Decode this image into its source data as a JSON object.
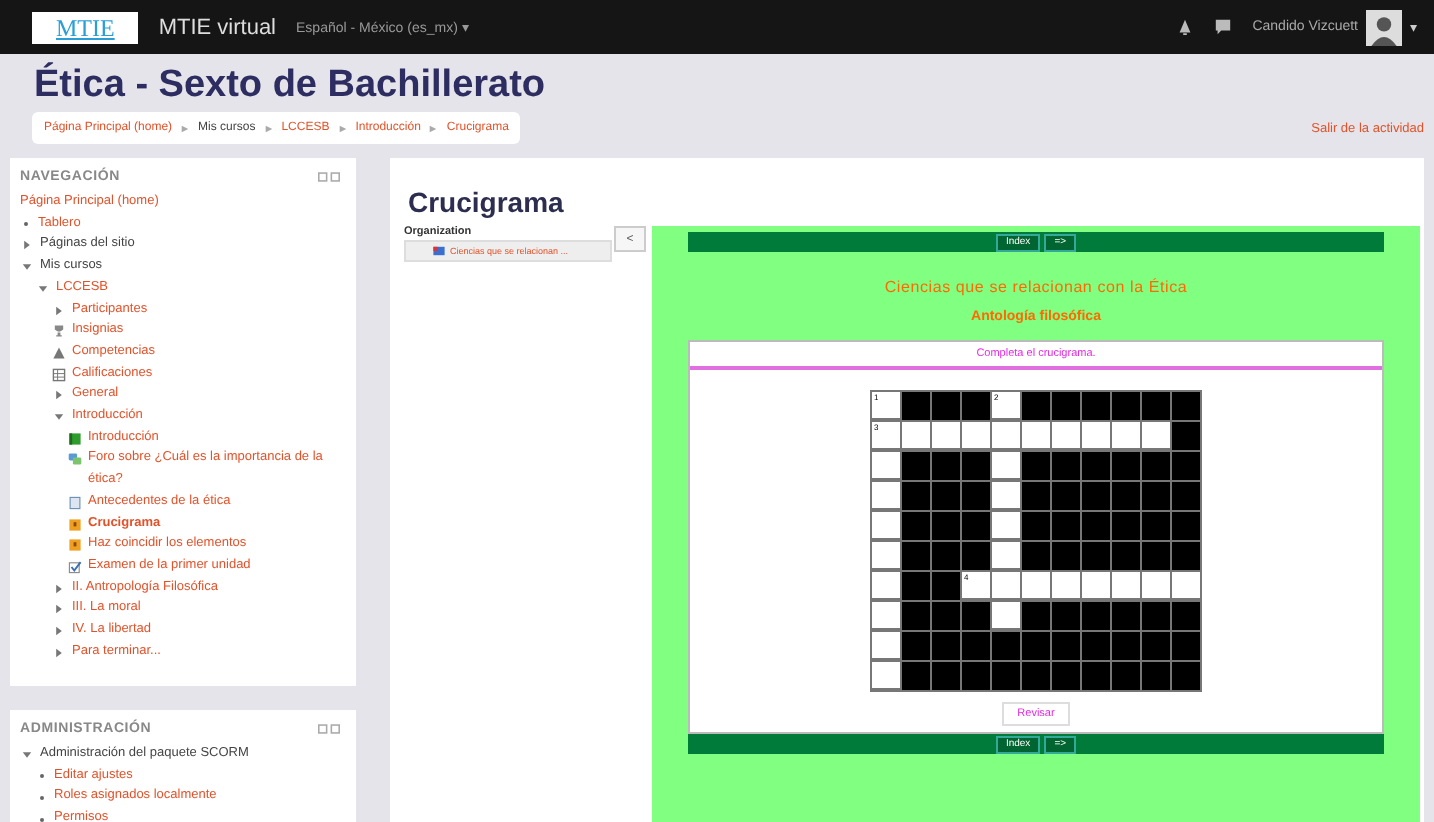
{
  "navbar": {
    "logo": "MTIE",
    "site_name": "MTIE virtual",
    "language": "Español - México (es_mx) ▾",
    "user_name": "Candido Vizcuett",
    "user_caret": "▾"
  },
  "page_title": "Ética - Sexto de Bachillerato",
  "breadcrumb": [
    {
      "label": "Página Principal (home)",
      "link": true
    },
    {
      "label": "Mis cursos",
      "link": false
    },
    {
      "label": "LCCESB",
      "link": true
    },
    {
      "label": "Introducción",
      "link": true
    },
    {
      "label": "Crucigrama",
      "link": true
    }
  ],
  "exit_link": "Salir de la actividad",
  "navigation": {
    "title": "NAVEGACIÓN",
    "items": [
      {
        "label": "Página Principal (home)",
        "kind": "plain",
        "link": true
      },
      {
        "label": "Tablero",
        "kind": "bullet",
        "link": true
      },
      {
        "label": "Páginas del sitio",
        "kind": "collapsed",
        "link": false
      },
      {
        "label": "Mis cursos",
        "kind": "expanded",
        "link": false,
        "children": [
          {
            "label": "LCCESB",
            "kind": "expanded",
            "link": true,
            "children": [
              {
                "label": "Participantes",
                "kind": "collapsed",
                "link": true
              },
              {
                "label": "Insignias",
                "kind": "badges",
                "link": true
              },
              {
                "label": "Competencias",
                "kind": "competencies",
                "link": true
              },
              {
                "label": "Calificaciones",
                "kind": "grades",
                "link": true
              },
              {
                "label": "General",
                "kind": "collapsed",
                "link": true
              },
              {
                "label": "Introducción",
                "kind": "expanded",
                "link": true,
                "children": [
                  {
                    "label": "Introducción",
                    "kind": "page",
                    "link": true,
                    "selected": false
                  },
                  {
                    "label": "Foro sobre ¿Cuál es la importancia de la ética?",
                    "kind": "forum",
                    "link": true,
                    "selected": false
                  },
                  {
                    "label": "Antecedentes de la ética",
                    "kind": "file",
                    "link": true,
                    "selected": false
                  },
                  {
                    "label": "Crucigrama",
                    "kind": "scorm",
                    "link": true,
                    "selected": true
                  },
                  {
                    "label": "Haz coincidir los elementos",
                    "kind": "scorm",
                    "link": true,
                    "selected": false
                  },
                  {
                    "label": "Examen de la primer unidad",
                    "kind": "quiz",
                    "link": true,
                    "selected": false
                  }
                ]
              },
              {
                "label": "II. Antropología Filosófica",
                "kind": "collapsed",
                "link": true
              },
              {
                "label": "III. La moral",
                "kind": "collapsed",
                "link": true
              },
              {
                "label": "IV. La libertad",
                "kind": "collapsed",
                "link": true
              },
              {
                "label": "Para terminar...",
                "kind": "collapsed",
                "link": true
              }
            ]
          }
        ]
      }
    ]
  },
  "administration": {
    "title": "ADMINISTRACIÓN",
    "items": [
      {
        "label": "Administración del paquete SCORM",
        "kind": "expanded",
        "link": false,
        "children": [
          {
            "label": "Editar ajustes",
            "kind": "bullet",
            "link": true
          },
          {
            "label": "Roles asignados localmente",
            "kind": "bullet",
            "link": true
          },
          {
            "label": "Permisos",
            "kind": "bullet",
            "link": true
          }
        ]
      }
    ]
  },
  "activity": {
    "title": "Crucigrama",
    "organization_label": "Organization",
    "organization_item": "Ciencias que se relacionan ...",
    "toggle_button": "<",
    "nav_top": [
      "Index",
      "=>"
    ],
    "heading": "Ciencias que se relacionan con la Ética",
    "subheading": "Antología filosófica",
    "instructions": "Completa el crucigrama.",
    "grid": [
      [
        {
          "open": true,
          "number": "1"
        },
        {
          "open": false
        },
        {
          "open": false
        },
        {
          "open": false
        },
        {
          "open": true,
          "number": "2"
        },
        {
          "open": false
        },
        {
          "open": false
        },
        {
          "open": false
        },
        {
          "open": false
        },
        {
          "open": false
        },
        {
          "open": false
        }
      ],
      [
        {
          "open": true,
          "number": "3"
        },
        {
          "open": true
        },
        {
          "open": true
        },
        {
          "open": true
        },
        {
          "open": true
        },
        {
          "open": true
        },
        {
          "open": true
        },
        {
          "open": true
        },
        {
          "open": true
        },
        {
          "open": true
        },
        {
          "open": false
        }
      ],
      [
        {
          "open": true
        },
        {
          "open": false
        },
        {
          "open": false
        },
        {
          "open": false
        },
        {
          "open": true
        },
        {
          "open": false
        },
        {
          "open": false
        },
        {
          "open": false
        },
        {
          "open": false
        },
        {
          "open": false
        },
        {
          "open": false
        }
      ],
      [
        {
          "open": true
        },
        {
          "open": false
        },
        {
          "open": false
        },
        {
          "open": false
        },
        {
          "open": true
        },
        {
          "open": false
        },
        {
          "open": false
        },
        {
          "open": false
        },
        {
          "open": false
        },
        {
          "open": false
        },
        {
          "open": false
        }
      ],
      [
        {
          "open": true
        },
        {
          "open": false
        },
        {
          "open": false
        },
        {
          "open": false
        },
        {
          "open": true
        },
        {
          "open": false
        },
        {
          "open": false
        },
        {
          "open": false
        },
        {
          "open": false
        },
        {
          "open": false
        },
        {
          "open": false
        }
      ],
      [
        {
          "open": true
        },
        {
          "open": false
        },
        {
          "open": false
        },
        {
          "open": false
        },
        {
          "open": true
        },
        {
          "open": false
        },
        {
          "open": false
        },
        {
          "open": false
        },
        {
          "open": false
        },
        {
          "open": false
        },
        {
          "open": false
        }
      ],
      [
        {
          "open": true
        },
        {
          "open": false
        },
        {
          "open": false
        },
        {
          "open": true,
          "number": "4"
        },
        {
          "open": true
        },
        {
          "open": true
        },
        {
          "open": true
        },
        {
          "open": true
        },
        {
          "open": true
        },
        {
          "open": true
        },
        {
          "open": true
        }
      ],
      [
        {
          "open": true
        },
        {
          "open": false
        },
        {
          "open": false
        },
        {
          "open": false
        },
        {
          "open": true
        },
        {
          "open": false
        },
        {
          "open": false
        },
        {
          "open": false
        },
        {
          "open": false
        },
        {
          "open": false
        },
        {
          "open": false
        }
      ],
      [
        {
          "open": true
        },
        {
          "open": false
        },
        {
          "open": false
        },
        {
          "open": false
        },
        {
          "open": false
        },
        {
          "open": false
        },
        {
          "open": false
        },
        {
          "open": false
        },
        {
          "open": false
        },
        {
          "open": false
        },
        {
          "open": false
        }
      ],
      [
        {
          "open": true
        },
        {
          "open": false
        },
        {
          "open": false
        },
        {
          "open": false
        },
        {
          "open": false
        },
        {
          "open": false
        },
        {
          "open": false
        },
        {
          "open": false
        },
        {
          "open": false
        },
        {
          "open": false
        },
        {
          "open": false
        }
      ]
    ],
    "check_button": "Revisar",
    "nav_bottom": [
      "Index",
      "=>"
    ]
  }
}
